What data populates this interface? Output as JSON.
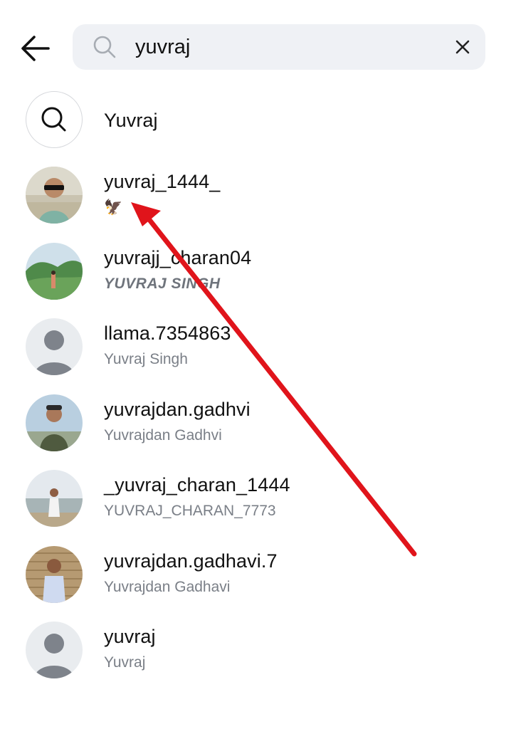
{
  "search": {
    "query": "yuvraj",
    "back_icon": "arrow-left-icon",
    "search_icon": "search-icon",
    "clear_icon": "close-icon"
  },
  "query_suggestion": {
    "label": "Yuvraj",
    "icon": "search-icon"
  },
  "results": [
    {
      "username": "yuvraj_1444_",
      "subtitle": "🦅",
      "avatar": "photo-sunglasses-man"
    },
    {
      "username": "yuvrajj_charan04",
      "subtitle": "YUVRAJ SINGH",
      "avatar": "photo-hills-landscape"
    },
    {
      "username": "llama.7354863",
      "subtitle": "Yuvraj Singh",
      "avatar": "default-person"
    },
    {
      "username": "yuvrajdan.gadhvi",
      "subtitle": "Yuvrajdan Gadhvi",
      "avatar": "photo-man-with-cap"
    },
    {
      "username": "_yuvraj_charan_1444",
      "subtitle": "YUVRAJ_CHARAN_7773",
      "avatar": "photo-man-by-water"
    },
    {
      "username": "yuvrajdan.gadhavi.7",
      "subtitle": "Yuvrajdan Gadhavi",
      "avatar": "photo-man-against-wall"
    },
    {
      "username": "yuvraj",
      "subtitle": "Yuvraj",
      "avatar": "default-person"
    }
  ],
  "colors": {
    "search_bg": "#eff1f5",
    "subtitle_text": "#7a7f87",
    "annotation_arrow": "#e0141b",
    "default_avatar_bg": "#e9ecef",
    "default_avatar_fg": "#7e838b"
  }
}
